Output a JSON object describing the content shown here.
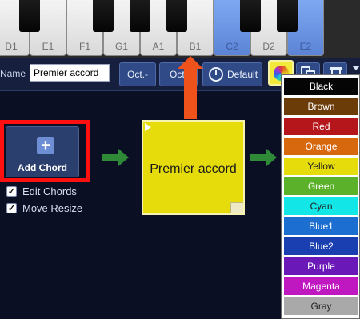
{
  "keyboard": {
    "white_keys": [
      {
        "label": "D1",
        "active": false
      },
      {
        "label": "E1",
        "active": false
      },
      {
        "label": "F1",
        "active": false
      },
      {
        "label": "G1",
        "active": false
      },
      {
        "label": "A1",
        "active": false
      },
      {
        "label": "B1",
        "active": false
      },
      {
        "label": "C2",
        "active": true
      },
      {
        "label": "D2",
        "active": false
      },
      {
        "label": "E2",
        "active": true
      }
    ]
  },
  "toolbar": {
    "name_label": "Name",
    "name_value": "Premier accord",
    "oct_down_label": "Oct.-",
    "oct_up_label": "Oct.",
    "default_label": "Default"
  },
  "main": {
    "add_chord_label": "Add Chord",
    "edit_chords_label": "Edit Chords",
    "edit_chords_checked": true,
    "move_resize_label": "Move Resize",
    "move_resize_checked": true
  },
  "chord_card": {
    "name": "Premier accord",
    "color": "#e6dc0c"
  },
  "color_menu": {
    "items": [
      {
        "label": "Black",
        "bg": "#050505",
        "fg": "#ffffff"
      },
      {
        "label": "Brown",
        "bg": "#6b3b08",
        "fg": "#ffffff"
      },
      {
        "label": "Red",
        "bg": "#b5161b",
        "fg": "#ffffff"
      },
      {
        "label": "Orange",
        "bg": "#d7680e",
        "fg": "#ffffff"
      },
      {
        "label": "Yellow",
        "bg": "#e6dc0c",
        "fg": "#222222"
      },
      {
        "label": "Green",
        "bg": "#5cb12a",
        "fg": "#ffffff"
      },
      {
        "label": "Cyan",
        "bg": "#12e6e6",
        "fg": "#222222"
      },
      {
        "label": "Blue1",
        "bg": "#1c6fd1",
        "fg": "#ffffff"
      },
      {
        "label": "Blue2",
        "bg": "#1a3fb0",
        "fg": "#ffffff"
      },
      {
        "label": "Purple",
        "bg": "#6a18b8",
        "fg": "#ffffff"
      },
      {
        "label": "Magenta",
        "bg": "#c018c0",
        "fg": "#ffffff"
      },
      {
        "label": "Gray",
        "bg": "#a9a9a9",
        "fg": "#222222"
      }
    ]
  }
}
